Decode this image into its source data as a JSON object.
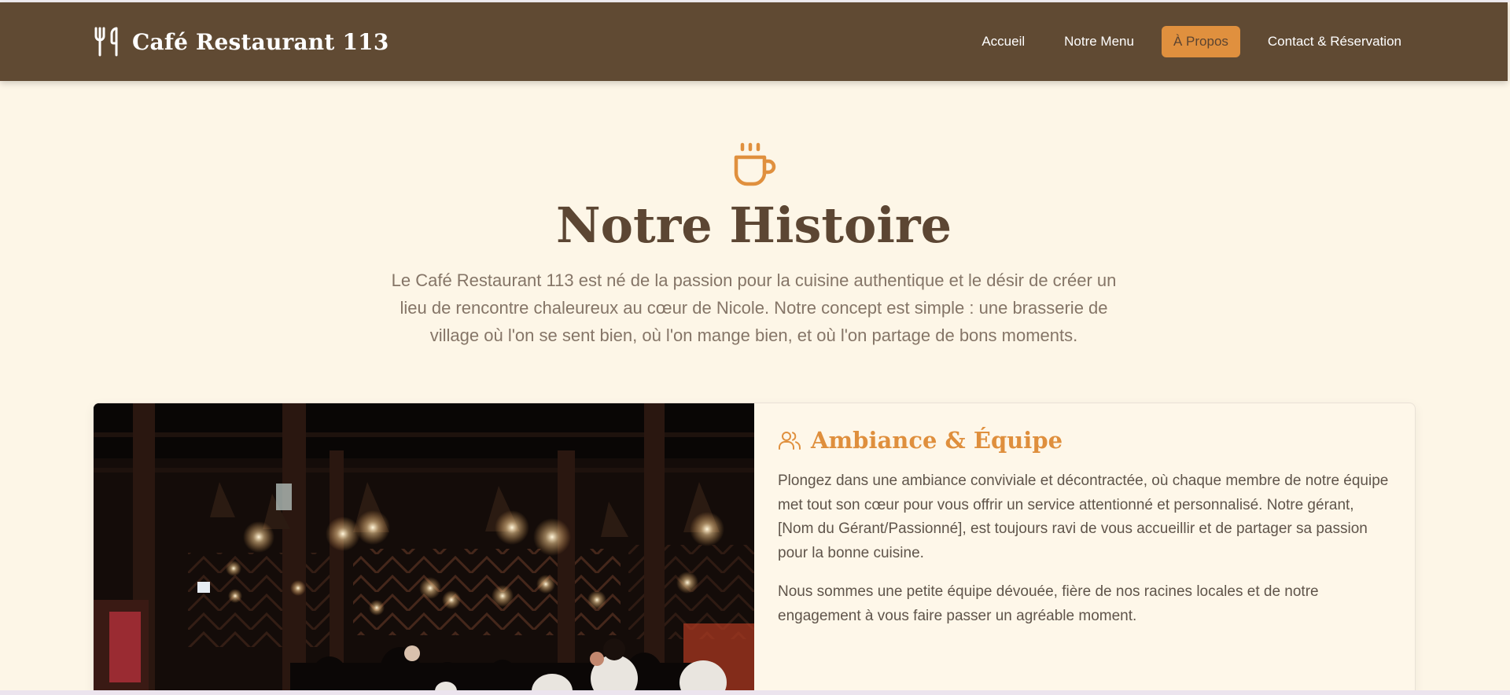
{
  "brand": {
    "name": "Café Restaurant 113",
    "icon": "utensils-icon"
  },
  "nav": {
    "items": [
      {
        "label": "Accueil",
        "active": false
      },
      {
        "label": "Notre Menu",
        "active": false
      },
      {
        "label": "À Propos",
        "active": true
      },
      {
        "label": "Contact & Réservation",
        "active": false
      }
    ]
  },
  "hero": {
    "icon": "coffee-cup-icon",
    "title": "Notre Histoire",
    "text": "Le Café Restaurant 113 est né de la passion pour la cuisine authentique et le désir de créer un lieu de rencontre chaleureux au cœur de Nicole. Notre concept est simple : une brasserie de village où l'on se sent bien, où l'on mange bien, et où l'on partage de bons moments."
  },
  "ambiance": {
    "icon": "users-icon",
    "title": "Ambiance & Équipe",
    "paragraphs": [
      "Plongez dans une ambiance conviviale et décontractée, où chaque membre de notre équipe met tout son cœur pour vous offrir un service attentionné et personnalisé. Notre gérant, [Nom du Gérant/Passionné], est toujours ravi de vous accueillir et de partager sa passion pour la bonne cuisine.",
      "Nous sommes une petite équipe dévouée, fière de nos racines locales et de notre engagement à vous faire passer un agréable moment."
    ]
  },
  "colors": {
    "nav_bg": "#604a33",
    "accent": "#e0903e",
    "page_bg": "#fdf6e7",
    "title": "#5c4633"
  }
}
